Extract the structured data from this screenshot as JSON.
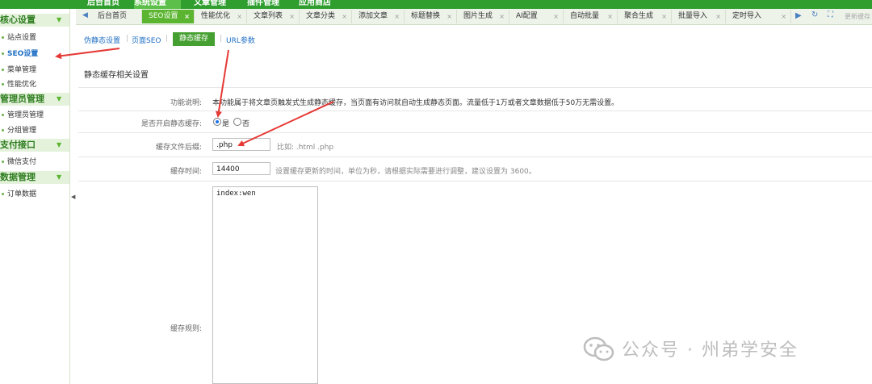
{
  "top_nav": [
    {
      "label": "后台首页"
    },
    {
      "label": "系统设置",
      "active": true
    },
    {
      "label": "文章管理"
    },
    {
      "label": "插件管理"
    },
    {
      "label": "应用商店"
    }
  ],
  "tabs": [
    {
      "label": "后台首页"
    },
    {
      "label": "SEO设置",
      "active": true
    },
    {
      "label": "性能优化"
    },
    {
      "label": "文章列表"
    },
    {
      "label": "文章分类"
    },
    {
      "label": "添加文章"
    },
    {
      "label": "标题替换"
    },
    {
      "label": "图片生成"
    },
    {
      "label": "AI配置"
    },
    {
      "label": "自动批量"
    },
    {
      "label": "聚合生成"
    },
    {
      "label": "批量导入"
    },
    {
      "label": "定时导入"
    }
  ],
  "tab_close_glyph": "×",
  "tab_nav": {
    "prev": "◀",
    "next": "▶",
    "refresh": "↻",
    "fullscreen": "⛶"
  },
  "refresh_text": "更新缓存",
  "sidebar": {
    "groups": [
      {
        "label": "核心设置",
        "items": [
          {
            "label": "站点设置"
          },
          {
            "label": "SEO设置",
            "active": true
          },
          {
            "label": "菜单管理"
          },
          {
            "label": "性能优化"
          }
        ]
      },
      {
        "label": "管理员管理",
        "items": [
          {
            "label": "管理员管理"
          },
          {
            "label": "分组管理"
          }
        ]
      },
      {
        "label": "支付接口",
        "items": [
          {
            "label": "微信支付"
          }
        ]
      },
      {
        "label": "数据管理",
        "items": [
          {
            "label": "订单数据"
          }
        ]
      }
    ],
    "toggle_glyph": "▼",
    "collapse_glyph": "◀"
  },
  "subtabs": [
    {
      "label": "伪静态设置"
    },
    {
      "label": "页面SEO"
    },
    {
      "label": "静态缓存",
      "active": true
    },
    {
      "label": "URL参数"
    }
  ],
  "section_title": "静态缓存相关设置",
  "form": {
    "description": {
      "label": "功能说明:",
      "text": "本功能属于将文章页触发式生成静态缓存，当页面有访问就自动生成静态页面。流量低于1万或者文章数据低于50万无需设置。"
    },
    "enable": {
      "label": "是否开启静态缓存:",
      "yes": "是",
      "no": "否",
      "selected": "yes"
    },
    "suffix": {
      "label": "缓存文件后缀:",
      "value": ".php",
      "hint": "比如: .html .php"
    },
    "cache_time": {
      "label": "缓存时间:",
      "value": "14400",
      "hint": "设置缓存更新的时间，单位为秒，请根据实际需要进行调整，建议设置为 3600。"
    },
    "rules": {
      "label": "缓存规则:",
      "value": "index:wen"
    }
  },
  "watermark": {
    "text": "公众号 · 州弟学安全"
  },
  "colors": {
    "accent_green": "#2f9e2f",
    "active_tab": "#5cb531",
    "link_blue": "#1f6fc4",
    "arrow_red": "#e53935"
  }
}
